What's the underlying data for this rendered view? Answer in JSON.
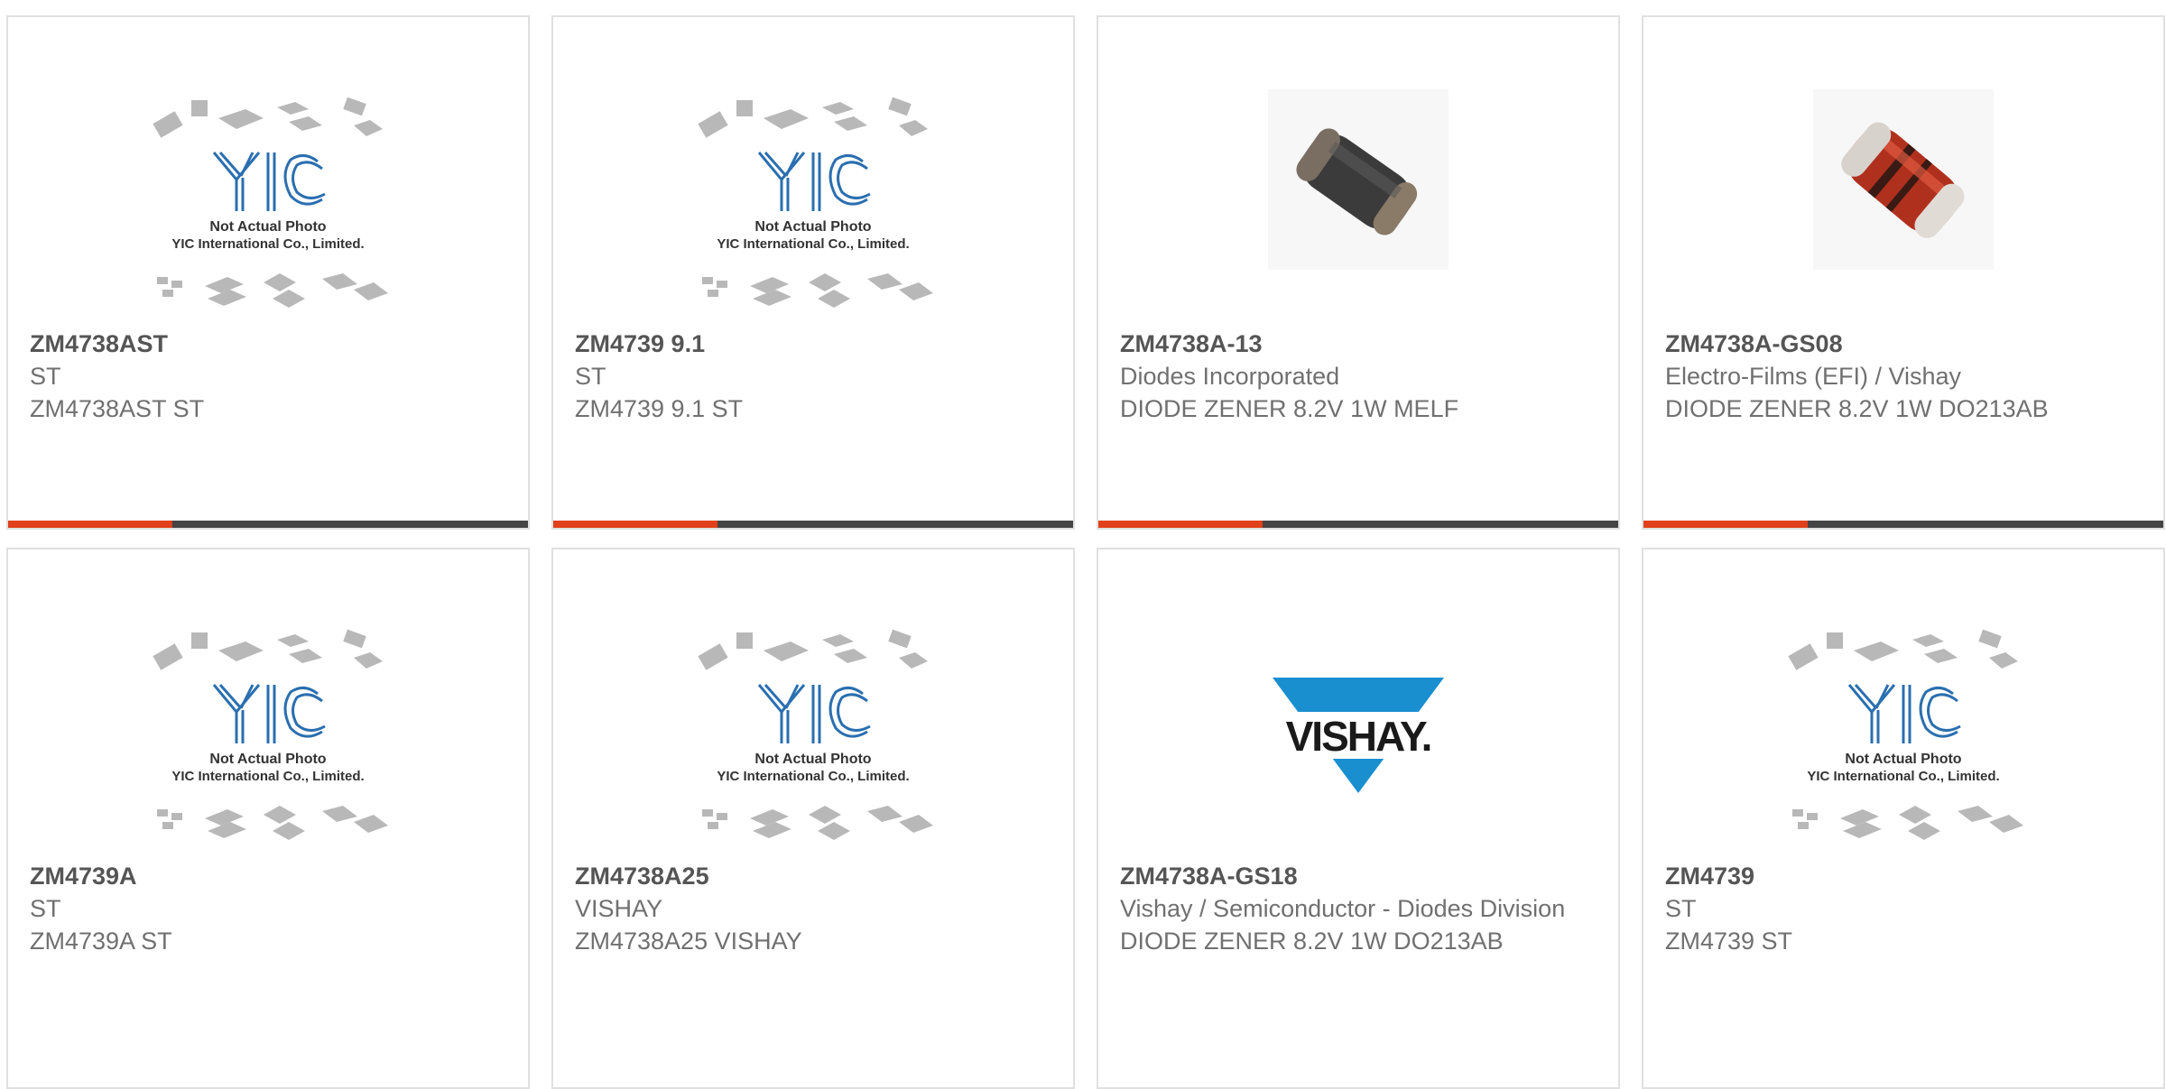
{
  "colors": {
    "accent": "#e0401a",
    "bar": "#444444",
    "yic_blue": "#2a6fb0",
    "vishay_blue": "#1a8fd0"
  },
  "placeholder": {
    "brand": "YIC",
    "caption_line1": "Not Actual Photo",
    "caption_line2": "YIC International Co., Limited."
  },
  "vishay_logo_text": "VISHAY.",
  "products": [
    {
      "part": "ZM4738AST",
      "manufacturer": "ST",
      "description": "ZM4738AST ST",
      "image": "placeholder"
    },
    {
      "part": "ZM4739 9.1",
      "manufacturer": "ST",
      "description": "ZM4739 9.1 ST",
      "image": "placeholder"
    },
    {
      "part": "ZM4738A-13",
      "manufacturer": "Diodes Incorporated",
      "description": "DIODE ZENER 8.2V 1W MELF",
      "image": "melf-black"
    },
    {
      "part": "ZM4738A-GS08",
      "manufacturer": "Electro-Films (EFI) / Vishay",
      "description": "DIODE ZENER 8.2V 1W DO213AB",
      "image": "melf-red"
    },
    {
      "part": "ZM4739A",
      "manufacturer": "ST",
      "description": "ZM4739A ST",
      "image": "placeholder"
    },
    {
      "part": "ZM4738A25",
      "manufacturer": "VISHAY",
      "description": "ZM4738A25 VISHAY",
      "image": "placeholder"
    },
    {
      "part": "ZM4738A-GS18",
      "manufacturer": "Vishay / Semiconductor - Diodes Division",
      "description": "DIODE ZENER 8.2V 1W DO213AB",
      "image": "vishay-logo"
    },
    {
      "part": "ZM4739",
      "manufacturer": "ST",
      "description": "ZM4739 ST",
      "image": "placeholder"
    }
  ]
}
